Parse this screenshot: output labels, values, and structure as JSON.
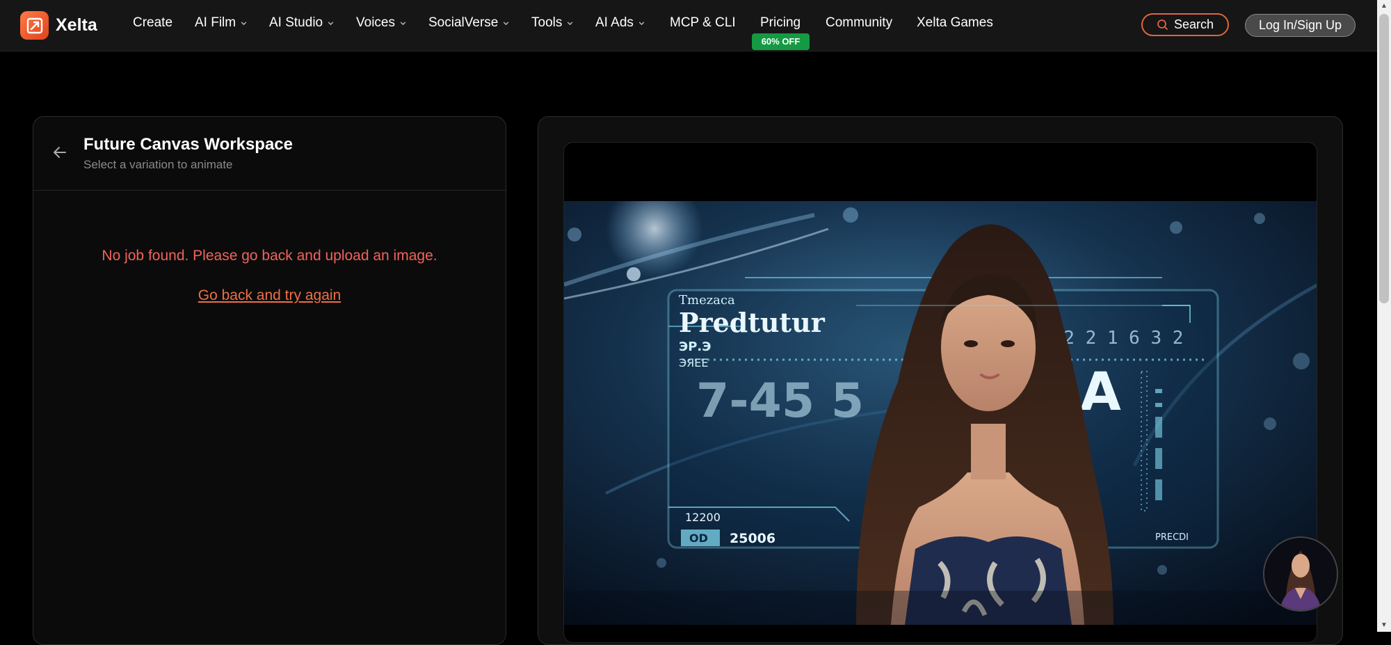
{
  "brand": {
    "name": "Xelta",
    "accent": "#e8582a"
  },
  "nav": {
    "items": [
      {
        "label": "Create",
        "dropdown": false
      },
      {
        "label": "AI Film",
        "dropdown": true
      },
      {
        "label": "AI Studio",
        "dropdown": true
      },
      {
        "label": "Voices",
        "dropdown": true
      },
      {
        "label": "SocialVerse",
        "dropdown": true
      },
      {
        "label": "Tools",
        "dropdown": true
      },
      {
        "label": "AI Ads",
        "dropdown": true
      },
      {
        "label": "MCP & CLI",
        "dropdown": false
      },
      {
        "label": "Pricing",
        "dropdown": false
      },
      {
        "label": "Community",
        "dropdown": false
      },
      {
        "label": "Xelta Games",
        "dropdown": false
      }
    ],
    "pricing_badge": "60% OFF",
    "search_label": "Search",
    "login_label": "Log In/Sign Up"
  },
  "workspace": {
    "title": "Future Canvas Workspace",
    "subtitle": "Select a variation to animate",
    "error_message": "No job found. Please go back and upload an image.",
    "retry_label": "Go back and try again"
  },
  "preview": {
    "hud_title": "Predtutur",
    "hud_small": "Tmezaca",
    "hud_code1": "ЭР.Э",
    "hud_code2": "ЭЯЕЕ",
    "hud_number": "7-45 5",
    "hud_letter": "A",
    "hud_top_numbers": "3173 2 2 1 6 3 2",
    "hud_bottom_num1": "12200",
    "hud_bottom_box": "OD",
    "hud_bottom_num2": "25006",
    "hud_side_label": "PRECDI"
  },
  "colors": {
    "nav_bg": "#161616",
    "badge_green": "#159a43",
    "error_red": "#f0645c",
    "link_orange": "#ef6f46",
    "hud_cyan": "#7fd8ef"
  }
}
